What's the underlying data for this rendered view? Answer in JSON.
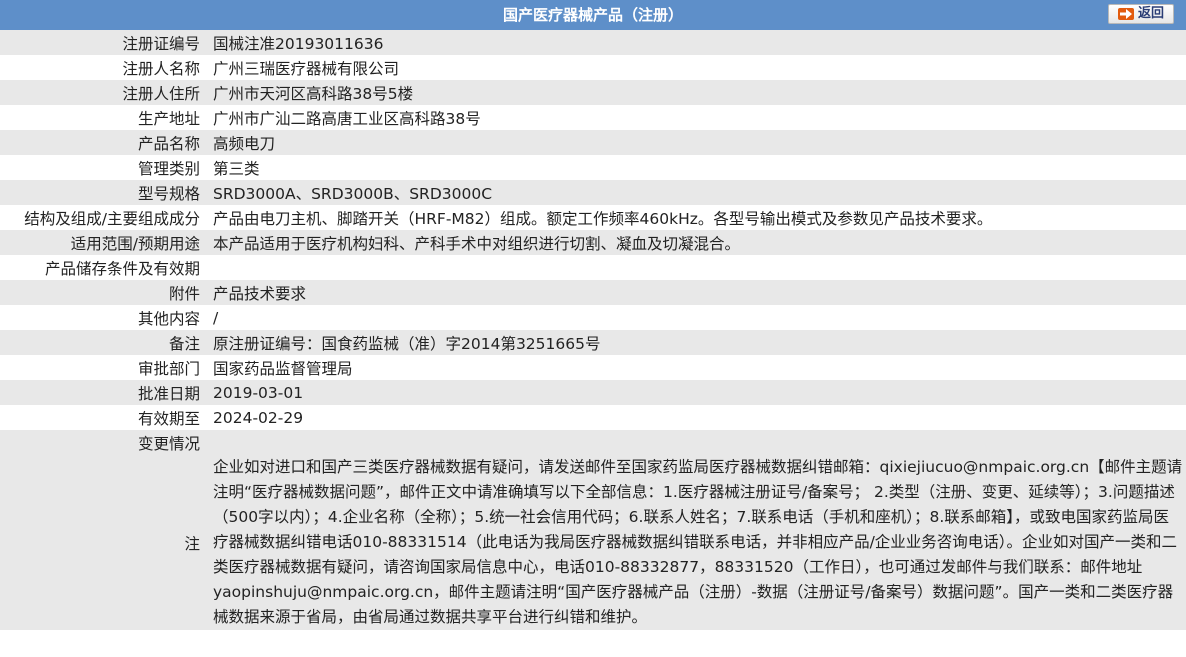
{
  "header": {
    "title": "国产医疗器械产品（注册）",
    "back_label": "返回"
  },
  "fields": [
    {
      "label": "注册证编号",
      "value": "国械注准20193011636"
    },
    {
      "label": "注册人名称",
      "value": "广州三瑞医疗器械有限公司"
    },
    {
      "label": "注册人住所",
      "value": "广州市天河区高科路38号5楼"
    },
    {
      "label": "生产地址",
      "value": "广州市广汕二路高唐工业区高科路38号"
    },
    {
      "label": "产品名称",
      "value": "高频电刀"
    },
    {
      "label": "管理类别",
      "value": "第三类"
    },
    {
      "label": "型号规格",
      "value": "SRD3000A、SRD3000B、SRD3000C"
    },
    {
      "label": "结构及组成/主要组成成分",
      "value": "产品由电刀主机、脚踏开关（HRF-M82）组成。额定工作频率460kHz。各型号输出模式及参数见产品技术要求。"
    },
    {
      "label": "适用范围/预期用途",
      "value": "本产品适用于医疗机构妇科、产科手术中对组织进行切割、凝血及切凝混合。"
    },
    {
      "label": "产品储存条件及有效期",
      "value": ""
    },
    {
      "label": "附件",
      "value": "产品技术要求"
    },
    {
      "label": "其他内容",
      "value": "/"
    },
    {
      "label": "备注",
      "value": "原注册证编号：国食药监械（准）字2014第3251665号"
    },
    {
      "label": "审批部门",
      "value": "国家药品监督管理局"
    },
    {
      "label": "批准日期",
      "value": "2019-03-01"
    },
    {
      "label": "有效期至",
      "value": "2024-02-29"
    },
    {
      "label": "变更情况",
      "value": ""
    }
  ],
  "note": {
    "label": "注",
    "text": "企业如对进口和国产三类医疗器械数据有疑问，请发送邮件至国家药监局医疗器械数据纠错邮箱：qixiejiucuo@nmpaic.org.cn【邮件主题请注明“医疗器械数据问题”，邮件正文中请准确填写以下全部信息：1.医疗器械注册证号/备案号； 2.类型（注册、变更、延续等）；3.问题描述（500字以内）；4.企业名称（全称）；5.统一社会信用代码；6.联系人姓名；7.联系电话（手机和座机）；8.联系邮箱】，或致电国家药监局医疗器械数据纠错电话010-88331514（此电话为我局医疗器械数据纠错联系电话，并非相应产品/企业业务咨询电话）。企业如对国产一类和二类医疗器械数据有疑问，请咨询国家局信息中心，电话010-88332877，88331520（工作日），也可通过发邮件与我们联系：邮件地址yaopinshuju@nmpaic.org.cn，邮件主题请注明“国产医疗器械产品（注册）-数据（注册证号/备案号）数据问题”。国产一类和二类医疗器械数据来源于省局，由省局通过数据共享平台进行纠错和维护。"
  }
}
